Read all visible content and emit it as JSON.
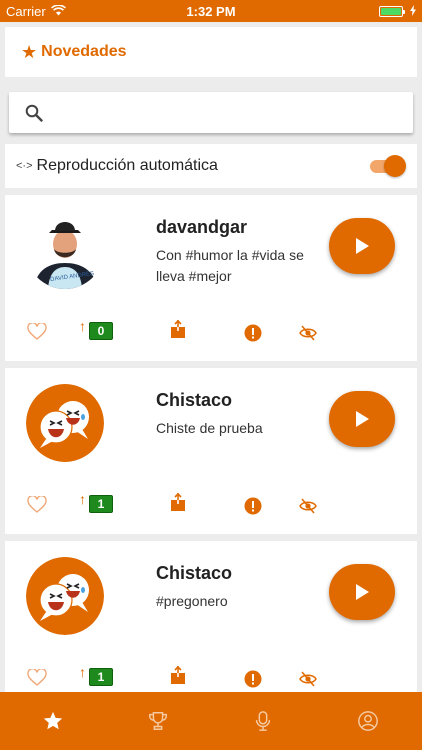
{
  "status_bar": {
    "carrier": "Carrier",
    "time": "1:32 PM"
  },
  "header": {
    "title": "Novedades",
    "icon": "star-icon"
  },
  "search": {
    "placeholder": "",
    "value": ""
  },
  "autoplay": {
    "label": "Reproducción automática",
    "enabled": true
  },
  "posts": [
    {
      "user": "davandgar",
      "text": "Con #humor la #vida se lleva #mejor",
      "upvotes": "0",
      "avatar": "person-photo"
    },
    {
      "user": "Chistaco",
      "text": "Chiste de prueba",
      "upvotes": "1",
      "avatar": "chistaco-logo"
    },
    {
      "user": "Chistaco",
      "text": "#pregonero",
      "upvotes": "1",
      "avatar": "chistaco-logo"
    }
  ],
  "tabs": [
    {
      "name": "star-icon",
      "active": true
    },
    {
      "name": "trophy-icon",
      "active": false
    },
    {
      "name": "microphone-icon",
      "active": false
    },
    {
      "name": "profile-icon",
      "active": false
    }
  ],
  "colors": {
    "accent": "#e06a00",
    "badge": "#1e8a1e",
    "background": "#ececec"
  }
}
